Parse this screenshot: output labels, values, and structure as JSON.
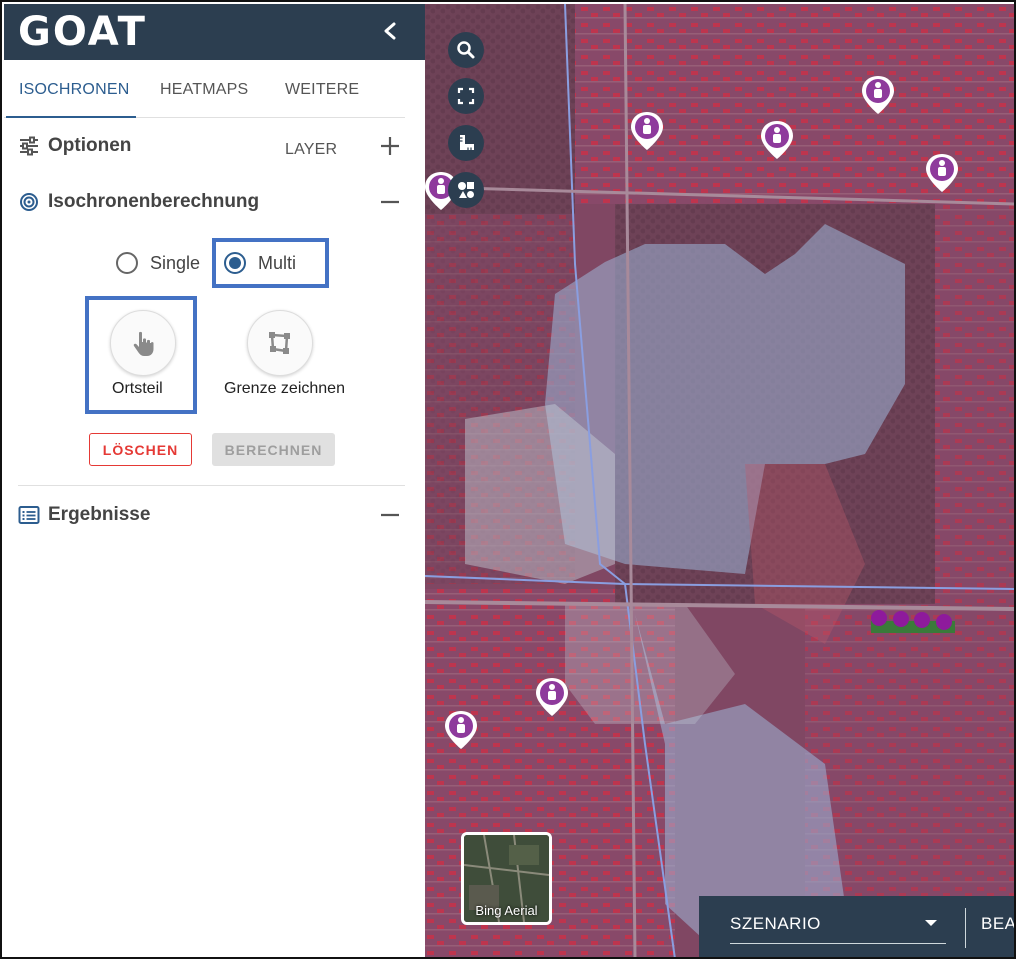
{
  "app": {
    "logo": "GOAT"
  },
  "tabs": [
    {
      "label": "ISOCHRONEN",
      "active": true
    },
    {
      "label": "HEATMAPS",
      "active": false
    },
    {
      "label": "WEITERE LAYER",
      "active": false
    }
  ],
  "sections": {
    "options": {
      "title": "Optionen",
      "toggle_icon": "plus-icon"
    },
    "isochrone": {
      "title": "Isochronenberechnung",
      "toggle_icon": "minus-icon"
    },
    "results": {
      "title": "Ergebnisse",
      "toggle_icon": "minus-icon"
    }
  },
  "calc_mode": {
    "options": [
      "Single",
      "Multi"
    ],
    "selected": "Multi"
  },
  "selection_tools": {
    "ortsteil": {
      "label": "Ortsteil",
      "icon": "hand-pointer-icon"
    },
    "draw": {
      "label": "Grenze zeichnen",
      "icon": "draw-polygon-icon"
    }
  },
  "actions": {
    "delete_label": "LÖSCHEN",
    "calculate_label": "BERECHNEN"
  },
  "map": {
    "basemap_label": "Bing Aerial",
    "scenario_label": "SZENARIO",
    "right_label": "BEA",
    "controls": [
      "search-icon",
      "fullscreen-icon",
      "ruler-icon",
      "shapes-icon"
    ]
  },
  "colors": {
    "header_bg": "#2c3e50",
    "accent": "#2c5d8f",
    "danger": "#e53935",
    "highlight": "#4472c4",
    "poi": "#8e3a9c"
  }
}
